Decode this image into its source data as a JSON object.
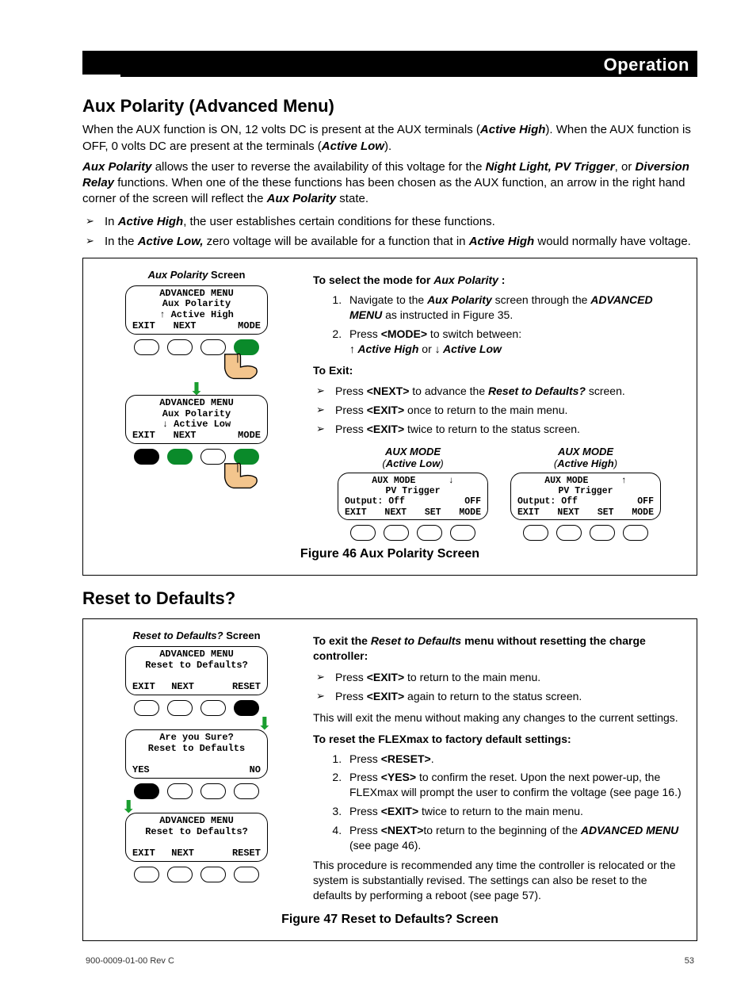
{
  "header": {
    "section": "Operation"
  },
  "sec1": {
    "title": "Aux Polarity (Advanced Menu)",
    "p1_a": "When the AUX function is ON, 12 volts DC is present at the AUX terminals (",
    "p1_b": "Active High",
    "p1_c": "). When the AUX function is OFF, 0 volts DC are present at the terminals (",
    "p1_d": "Active Low",
    "p1_e": ").",
    "p2_a": "Aux Polarity",
    "p2_b": " allows the user to reverse the availability of this voltage for the ",
    "p2_c": "Night Light, PV Trigger",
    "p2_d": ", or ",
    "p2_e": "Diversion Relay",
    "p2_f": " functions.   When one of the these functions has been chosen as the AUX function, an arrow in the right hand corner of the screen will reflect the ",
    "p2_g": "Aux Polarity",
    "p2_h": " state.",
    "bul1_a": "In ",
    "bul1_b": "Active High",
    "bul1_c": ", the user establishes certain conditions for these functions.",
    "bul2_a": "In the ",
    "bul2_b": "Active Low,",
    "bul2_c": " zero voltage will be available for a function that in ",
    "bul2_d": "Active High",
    "bul2_e": " would normally have voltage."
  },
  "fig46": {
    "screenTitle_a": "Aux Polarity",
    "screenTitle_b": " Screen",
    "lcd1": {
      "l1": "ADVANCED MENU",
      "l2": "Aux Polarity",
      "l3": "↑ Active High",
      "b1": "EXIT",
      "b2": "NEXT",
      "b4": "MODE"
    },
    "lcd2": {
      "l1": "ADVANCED MENU",
      "l2": "Aux Polarity",
      "l3": "↓ Active Low",
      "b1": "EXIT",
      "b2": "NEXT",
      "b4": "MODE"
    },
    "right": {
      "head1_a": "To select the mode for ",
      "head1_b": "Aux Polarity",
      "head1_c": " :",
      "li1_a": "Navigate to the ",
      "li1_b": "Aux Polarity",
      "li1_c": " screen through the ",
      "li1_d": "ADVANCED MENU",
      "li1_e": " as instructed in Figure 35.",
      "li2_a": "Press ",
      "li2_b": "<MODE>",
      "li2_c": " to switch between:",
      "li2_d": "↑",
      "li2_e": " Active High",
      "li2_f": " or ",
      "li2_g": "↓",
      "li2_h": " Active Low",
      "exitHead": "To Exit:",
      "ex1_a": "Press ",
      "ex1_b": "<NEXT>",
      "ex1_c": " to advance the ",
      "ex1_d": "Reset to Defaults?",
      "ex1_e": " screen.",
      "ex2_a": "Press ",
      "ex2_b": "<EXIT>",
      "ex2_c": " once to return to the main menu.",
      "ex3_a": "Press ",
      "ex3_b": "<EXIT>",
      "ex3_c": " twice to return to the status screen."
    },
    "mini": {
      "leftTitle1": "AUX MODE",
      "leftTitle2": "(Active Low)",
      "rightTitle1": "AUX MODE",
      "rightTitle2": "(Active High)",
      "lcdL": {
        "l1": "AUX MODE      ↓",
        "l2": "PV Trigger",
        "l3a": "Output: Off",
        "l3b": "OFF",
        "b1": "EXIT",
        "b2": "NEXT",
        "b3": "SET",
        "b4": "MODE"
      },
      "lcdR": {
        "l1": "AUX MODE      ↑",
        "l2": "PV Trigger",
        "l3a": "Output: Off",
        "l3b": "OFF",
        "b1": "EXIT",
        "b2": "NEXT",
        "b3": "SET",
        "b4": "MODE"
      }
    },
    "caption": "Figure 46       Aux Polarity Screen"
  },
  "sec2": {
    "title": "Reset to Defaults?"
  },
  "fig47": {
    "screenTitle_a": "Reset to Defaults?",
    "screenTitle_b": " Screen",
    "lcd1": {
      "l1": "ADVANCED MENU",
      "l2": "Reset to Defaults?",
      "b1": "EXIT",
      "b2": "NEXT",
      "b4": "RESET"
    },
    "lcd2": {
      "l1": "Are you Sure?",
      "l2": "Reset to Defaults",
      "b1": "YES",
      "b4": "NO"
    },
    "lcd3": {
      "l1": "ADVANCED MENU",
      "l2": "Reset to Defaults?",
      "b1": "EXIT",
      "b2": "NEXT",
      "b4": "RESET"
    },
    "right": {
      "head1_a": "To exit the ",
      "head1_b": "Reset to Defaults",
      "head1_c": " menu without resetting the charge controller:",
      "ex1_a": "Press ",
      "ex1_b": "<EXIT>",
      "ex1_c": " to return to the main menu.",
      "ex2_a": "Press ",
      "ex2_b": "<EXIT>",
      "ex2_c": " again to return to the status screen.",
      "after": "This will exit the menu without making any changes to the current settings.",
      "head2": "To reset the FLEXmax to factory default settings:",
      "li1_a": "Press ",
      "li1_b": "<RESET>",
      "li1_c": ".",
      "li2_a": "Press ",
      "li2_b": "<YES>",
      "li2_c": " to confirm the reset.  Upon the next power-up, the FLEXmax will prompt the user to confirm the voltage (see page 16.)",
      "li3_a": "Press ",
      "li3_b": "<EXIT>",
      "li3_c": " twice to return to the main menu.",
      "li4_a": "Press ",
      "li4_b": "<NEXT>",
      "li4_c": "to return to the beginning of the ",
      "li4_d": "ADVANCED MENU",
      "li4_e": " (see page 46).",
      "tail": "This procedure is recommended any time the controller is relocated or the system is substantially revised.  The settings can also be reset to the defaults by performing a reboot (see page 57)."
    },
    "caption": "Figure 47       Reset to Defaults? Screen"
  },
  "footer": {
    "left": "900-0009-01-00 Rev C",
    "right": "53"
  }
}
